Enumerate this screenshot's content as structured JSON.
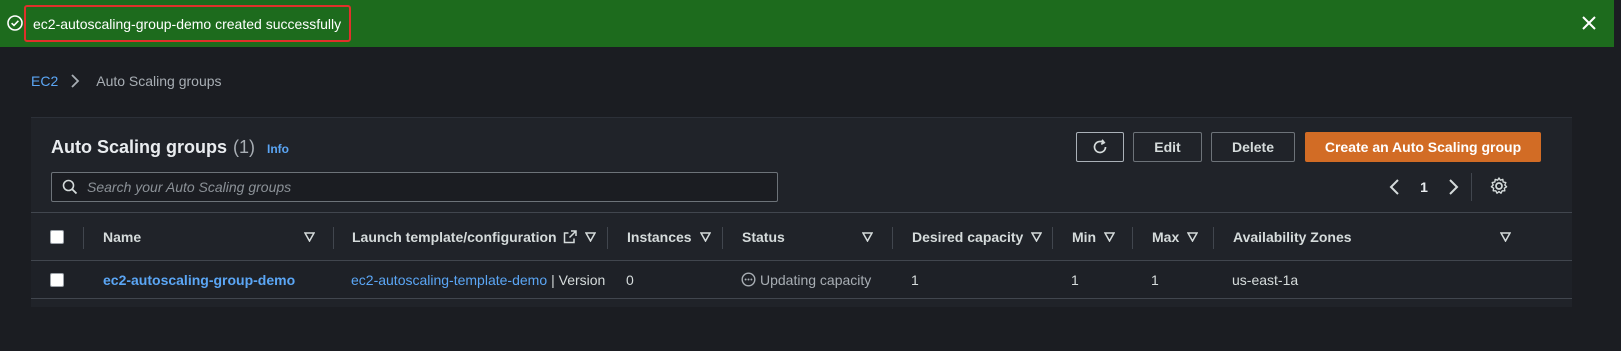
{
  "flash": {
    "message": "ec2-autoscaling-group-demo created successfully",
    "icons": {
      "status": "success-check-icon",
      "close": "close-icon"
    },
    "color": "#1d6b1d"
  },
  "breadcrumb": {
    "root": "EC2",
    "current": "Auto Scaling groups"
  },
  "panel": {
    "title": "Auto Scaling groups",
    "count": "(1)",
    "info": "Info",
    "buttons": {
      "edit": "Edit",
      "delete": "Delete",
      "create": "Create an Auto Scaling group"
    },
    "search_placeholder": "Search your Auto Scaling groups",
    "page": "1",
    "accent_color": "#d26c25"
  },
  "table": {
    "columns": [
      "Name",
      "Launch template/configuration",
      "Instances",
      "Status",
      "Desired capacity",
      "Min",
      "Max",
      "Availability Zones"
    ],
    "rows": [
      {
        "name": "ec2-autoscaling-group-demo",
        "launch_template": "ec2-autoscaling-template-demo",
        "launch_suffix": "| Version",
        "instances": "0",
        "status": "Updating capacity",
        "desired": "1",
        "min": "1",
        "max": "1",
        "az": "us-east-1a"
      }
    ]
  }
}
